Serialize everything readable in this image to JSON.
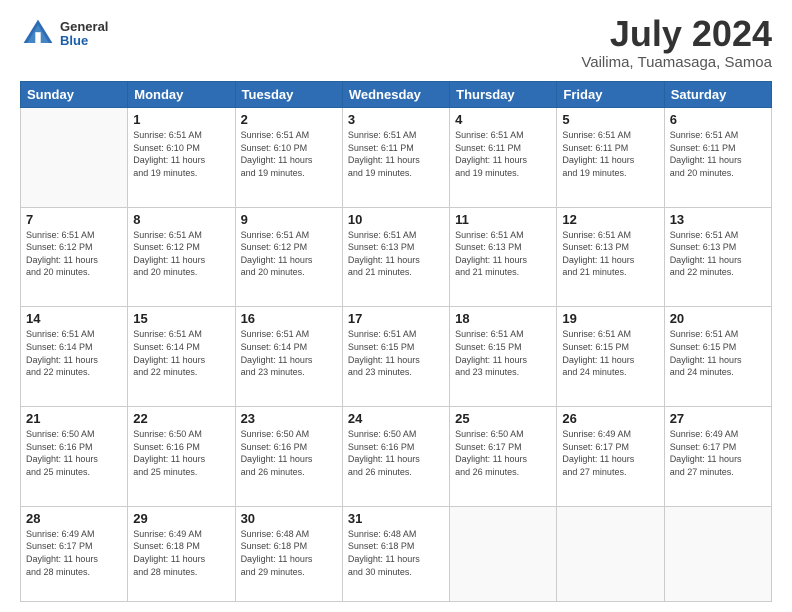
{
  "header": {
    "logo_general": "General",
    "logo_blue": "Blue",
    "title": "July 2024",
    "subtitle": "Vailima, Tuamasaga, Samoa"
  },
  "days_of_week": [
    "Sunday",
    "Monday",
    "Tuesday",
    "Wednesday",
    "Thursday",
    "Friday",
    "Saturday"
  ],
  "weeks": [
    [
      {
        "day": "",
        "info": ""
      },
      {
        "day": "1",
        "info": "Sunrise: 6:51 AM\nSunset: 6:10 PM\nDaylight: 11 hours\nand 19 minutes."
      },
      {
        "day": "2",
        "info": "Sunrise: 6:51 AM\nSunset: 6:10 PM\nDaylight: 11 hours\nand 19 minutes."
      },
      {
        "day": "3",
        "info": "Sunrise: 6:51 AM\nSunset: 6:11 PM\nDaylight: 11 hours\nand 19 minutes."
      },
      {
        "day": "4",
        "info": "Sunrise: 6:51 AM\nSunset: 6:11 PM\nDaylight: 11 hours\nand 19 minutes."
      },
      {
        "day": "5",
        "info": "Sunrise: 6:51 AM\nSunset: 6:11 PM\nDaylight: 11 hours\nand 19 minutes."
      },
      {
        "day": "6",
        "info": "Sunrise: 6:51 AM\nSunset: 6:11 PM\nDaylight: 11 hours\nand 20 minutes."
      }
    ],
    [
      {
        "day": "7",
        "info": "Sunrise: 6:51 AM\nSunset: 6:12 PM\nDaylight: 11 hours\nand 20 minutes."
      },
      {
        "day": "8",
        "info": "Sunrise: 6:51 AM\nSunset: 6:12 PM\nDaylight: 11 hours\nand 20 minutes."
      },
      {
        "day": "9",
        "info": "Sunrise: 6:51 AM\nSunset: 6:12 PM\nDaylight: 11 hours\nand 20 minutes."
      },
      {
        "day": "10",
        "info": "Sunrise: 6:51 AM\nSunset: 6:13 PM\nDaylight: 11 hours\nand 21 minutes."
      },
      {
        "day": "11",
        "info": "Sunrise: 6:51 AM\nSunset: 6:13 PM\nDaylight: 11 hours\nand 21 minutes."
      },
      {
        "day": "12",
        "info": "Sunrise: 6:51 AM\nSunset: 6:13 PM\nDaylight: 11 hours\nand 21 minutes."
      },
      {
        "day": "13",
        "info": "Sunrise: 6:51 AM\nSunset: 6:13 PM\nDaylight: 11 hours\nand 22 minutes."
      }
    ],
    [
      {
        "day": "14",
        "info": "Sunrise: 6:51 AM\nSunset: 6:14 PM\nDaylight: 11 hours\nand 22 minutes."
      },
      {
        "day": "15",
        "info": "Sunrise: 6:51 AM\nSunset: 6:14 PM\nDaylight: 11 hours\nand 22 minutes."
      },
      {
        "day": "16",
        "info": "Sunrise: 6:51 AM\nSunset: 6:14 PM\nDaylight: 11 hours\nand 23 minutes."
      },
      {
        "day": "17",
        "info": "Sunrise: 6:51 AM\nSunset: 6:15 PM\nDaylight: 11 hours\nand 23 minutes."
      },
      {
        "day": "18",
        "info": "Sunrise: 6:51 AM\nSunset: 6:15 PM\nDaylight: 11 hours\nand 23 minutes."
      },
      {
        "day": "19",
        "info": "Sunrise: 6:51 AM\nSunset: 6:15 PM\nDaylight: 11 hours\nand 24 minutes."
      },
      {
        "day": "20",
        "info": "Sunrise: 6:51 AM\nSunset: 6:15 PM\nDaylight: 11 hours\nand 24 minutes."
      }
    ],
    [
      {
        "day": "21",
        "info": "Sunrise: 6:50 AM\nSunset: 6:16 PM\nDaylight: 11 hours\nand 25 minutes."
      },
      {
        "day": "22",
        "info": "Sunrise: 6:50 AM\nSunset: 6:16 PM\nDaylight: 11 hours\nand 25 minutes."
      },
      {
        "day": "23",
        "info": "Sunrise: 6:50 AM\nSunset: 6:16 PM\nDaylight: 11 hours\nand 26 minutes."
      },
      {
        "day": "24",
        "info": "Sunrise: 6:50 AM\nSunset: 6:16 PM\nDaylight: 11 hours\nand 26 minutes."
      },
      {
        "day": "25",
        "info": "Sunrise: 6:50 AM\nSunset: 6:17 PM\nDaylight: 11 hours\nand 26 minutes."
      },
      {
        "day": "26",
        "info": "Sunrise: 6:49 AM\nSunset: 6:17 PM\nDaylight: 11 hours\nand 27 minutes."
      },
      {
        "day": "27",
        "info": "Sunrise: 6:49 AM\nSunset: 6:17 PM\nDaylight: 11 hours\nand 27 minutes."
      }
    ],
    [
      {
        "day": "28",
        "info": "Sunrise: 6:49 AM\nSunset: 6:17 PM\nDaylight: 11 hours\nand 28 minutes."
      },
      {
        "day": "29",
        "info": "Sunrise: 6:49 AM\nSunset: 6:18 PM\nDaylight: 11 hours\nand 28 minutes."
      },
      {
        "day": "30",
        "info": "Sunrise: 6:48 AM\nSunset: 6:18 PM\nDaylight: 11 hours\nand 29 minutes."
      },
      {
        "day": "31",
        "info": "Sunrise: 6:48 AM\nSunset: 6:18 PM\nDaylight: 11 hours\nand 30 minutes."
      },
      {
        "day": "",
        "info": ""
      },
      {
        "day": "",
        "info": ""
      },
      {
        "day": "",
        "info": ""
      }
    ]
  ]
}
